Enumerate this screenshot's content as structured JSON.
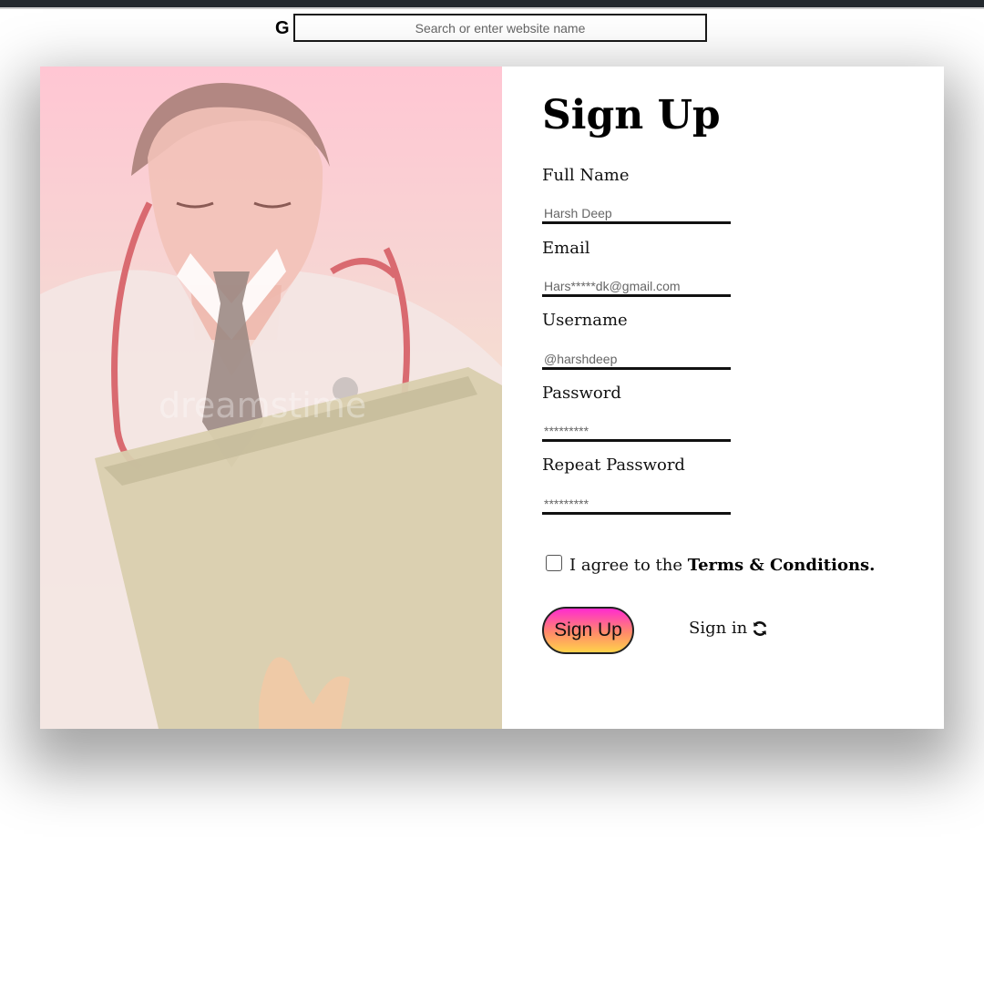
{
  "browser": {
    "search_icon_glyph": "G",
    "search_placeholder": "Search or enter website name"
  },
  "hero_image": {
    "subject": "doctor-with-laptop",
    "watermark": "dreamstime"
  },
  "form": {
    "title": "Sign Up",
    "fields": [
      {
        "label": "Full Name",
        "placeholder": "Harsh Deep"
      },
      {
        "label": "Email",
        "placeholder": "Hars*****dk@gmail.com"
      },
      {
        "label": "Username",
        "placeholder": "@harshdeep"
      },
      {
        "label": "Password",
        "placeholder": "*********"
      },
      {
        "label": "Repeat Password",
        "placeholder": "*********"
      }
    ],
    "agree": {
      "prefix": "I agree to the",
      "terms_link": "Terms & Conditions."
    },
    "submit_label": "Sign Up",
    "signin_label": "Sign in",
    "signin_icon": "refresh-icon"
  },
  "colors": {
    "top_strip": "#24292e",
    "photo_overlay_top": "#ffc6d3",
    "photo_overlay_bottom": "#fdf7cf",
    "button_gradient_top": "#ff2bd0",
    "button_gradient_bottom": "#ffd24a"
  }
}
